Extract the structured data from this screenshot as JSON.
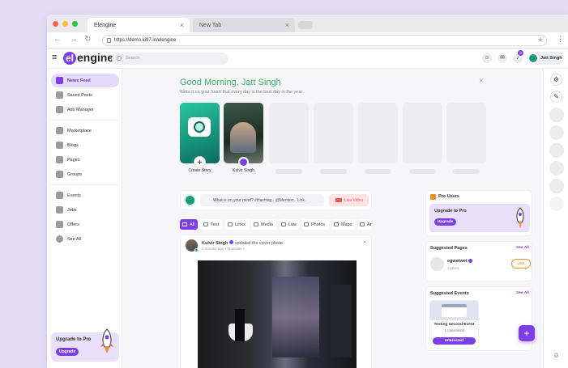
{
  "browser": {
    "tabs": [
      {
        "label": "Elengine",
        "close": "×"
      },
      {
        "label": "New Tab",
        "close": "×"
      }
    ],
    "url": "https://demo.ki97.in/elengine",
    "nav": {
      "back": "←",
      "forward": "→",
      "reload": "↻"
    },
    "star": "★",
    "menu": "⋮"
  },
  "topnav": {
    "hamburger": "≡",
    "logo_letter": "el",
    "logo_rest": "engine.",
    "search_placeholder": "Search",
    "notification_count": "3",
    "user_name": "Jatt Singh"
  },
  "sidebar": {
    "items": [
      {
        "label": "News Feed",
        "icon": "news-icon"
      },
      {
        "label": "Saved Posts",
        "icon": "bookmark-icon"
      },
      {
        "label": "Ads Manager",
        "icon": "ads-icon"
      },
      {
        "label": "Marketplace",
        "icon": "store-icon"
      },
      {
        "label": "Blogs",
        "icon": "blog-icon"
      },
      {
        "label": "Pages",
        "icon": "flag-icon"
      },
      {
        "label": "Groups",
        "icon": "groups-icon"
      },
      {
        "label": "Events",
        "icon": "calendar-icon"
      },
      {
        "label": "Jobs",
        "icon": "briefcase-icon"
      },
      {
        "label": "Offers",
        "icon": "tag-icon"
      },
      {
        "label": "See All",
        "icon": "grid-icon"
      }
    ],
    "upgrade": {
      "title": "Upgrade to Pro",
      "button": "Upgrade"
    }
  },
  "greeting": {
    "title": "Good Morning, Jatt Singh",
    "subtitle": "Write it on your heart that every day is the best day in the year",
    "close": "×"
  },
  "stories": [
    {
      "label": "Create Story",
      "plus": "+"
    },
    {
      "label": "Kulvir Singh"
    }
  ],
  "composer": {
    "placeholder": "What is on your mind? #Hashtag.. @Mention.. Link..",
    "live": "Live Video"
  },
  "filters": [
    "All",
    "Text",
    "Links",
    "Media",
    "Live",
    "Photos",
    "Maps",
    "Ar"
  ],
  "post": {
    "author": "Kulvir Singh",
    "action": "updated the cover photo",
    "meta": "2 months ago • Translate •",
    "menu": "⌄"
  },
  "pro_users": {
    "title": "Pro Users",
    "upgrade_title": "Upgrade to Pro",
    "button": "Upgrade"
  },
  "suggested_pages": {
    "title": "Suggested Pages",
    "see_all": "See All",
    "page_name": "egwetwet",
    "likes": "1 Likes",
    "like_button": "Like"
  },
  "suggested_events": {
    "title": "Suggested Events",
    "see_all": "See All",
    "event_name": "Testing Second Event",
    "interested_count": "1 Interested",
    "button": "Interested"
  },
  "fab": "+",
  "colors": {
    "accent": "#7b3fe4",
    "greeting": "#35b36a",
    "live": "#e85a5a"
  }
}
